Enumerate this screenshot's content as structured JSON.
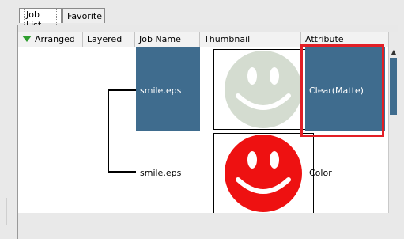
{
  "tabs": [
    {
      "label": "Job List",
      "active": true
    },
    {
      "label": "Favorite",
      "active": false
    }
  ],
  "columns": {
    "arranged": "Arranged",
    "layered": "Layered",
    "job_name": "Job Name",
    "thumbnail": "Thumbnail",
    "attribute": "Attribute"
  },
  "rows": [
    {
      "job_name": "smile.eps",
      "attribute": "Clear(Matte)",
      "thumbnail_icon": "smiley-clear-icon",
      "selected": true
    },
    {
      "job_name": "smile.eps",
      "attribute": "Color",
      "thumbnail_icon": "smiley-red-icon",
      "selected": false
    }
  ],
  "colors": {
    "selection_blue": "#3f6c8e",
    "highlight_red": "#e21f26",
    "smiley_clear": "#d4dcd0",
    "smiley_red": "#ee1111",
    "arrow_green": "#2f9e2f"
  },
  "icons": {
    "arranged_sort": "arrow-down-icon",
    "scroll_up": "scroll-up-arrow-icon"
  }
}
